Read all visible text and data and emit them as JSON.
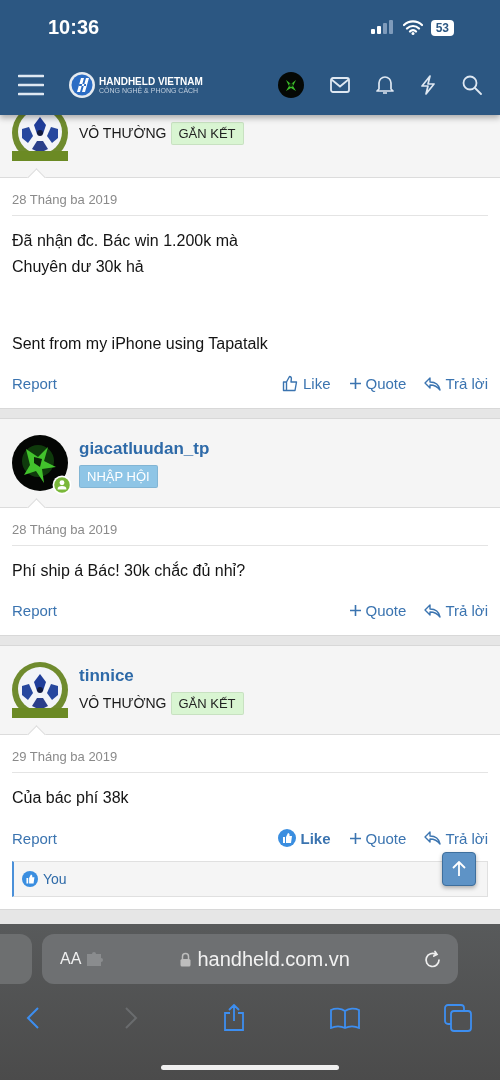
{
  "status_bar": {
    "time": "10:36",
    "battery": "53"
  },
  "header": {
    "logo_title": "HANDHELD VIETNAM",
    "logo_subtitle": "CÔNG NGHỆ & PHONG CÁCH"
  },
  "posts": [
    {
      "rank": "VÔ THƯỜNG",
      "badge": {
        "label": "GẮN KẾT",
        "color": "#d9f5d2"
      },
      "online": false,
      "date": "28 Tháng ba 2019",
      "paragraphs": [
        "Đã nhận đc. Bác win 1.200k mà\nChuyên dư 30k hả",
        "Sent from my iPhone using Tapatalk"
      ],
      "actions": [
        {
          "kind": "report",
          "label": "Report"
        },
        {
          "kind": "like",
          "label": "Like",
          "selected": false
        },
        {
          "kind": "quote",
          "label": "Quote"
        },
        {
          "kind": "reply",
          "label": "Trả lời"
        }
      ]
    },
    {
      "author": "giacatluudan_tp",
      "badge": {
        "label": "NHẬP HỘI",
        "color": "#8ec5e6"
      },
      "online": true,
      "date": "28 Tháng ba 2019",
      "paragraphs": [
        "Phí ship á Bác! 30k chắc đủ nhỉ?"
      ],
      "actions": [
        {
          "kind": "report",
          "label": "Report"
        },
        {
          "kind": "quote",
          "label": "Quote"
        },
        {
          "kind": "reply",
          "label": "Trả lời"
        }
      ]
    },
    {
      "author": "tinnice",
      "rank": "VÔ THƯỜNG",
      "badge": {
        "label": "GẮN KẾT",
        "color": "#d9f5d2"
      },
      "online": false,
      "date": "29 Tháng ba 2019",
      "paragraphs": [
        "Của bác phí 38k"
      ],
      "actions": [
        {
          "kind": "report",
          "label": "Report"
        },
        {
          "kind": "like",
          "label": "Like",
          "selected": true
        },
        {
          "kind": "quote",
          "label": "Quote"
        },
        {
          "kind": "reply",
          "label": "Trả lời"
        }
      ],
      "likes": "You"
    }
  ],
  "browser": {
    "text_size": "AA",
    "url": "handheld.com.vn"
  }
}
